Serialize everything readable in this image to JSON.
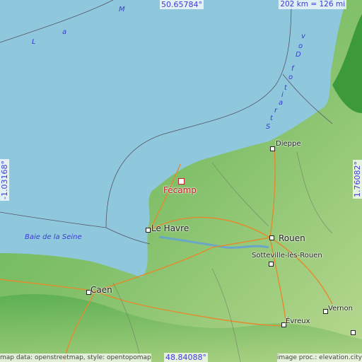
{
  "map": {
    "coordinates": {
      "north": "50.65784°",
      "south": "48.84088°",
      "west": "-1.03168°",
      "east": "1.76082°"
    },
    "scale_label": "202 km = 126 mi",
    "attribution_left": "map data: openstreetmap, style: opentopomap",
    "attribution_right": "image proc.: elevation.city",
    "highlighted_place": "Fécamp",
    "colors": {
      "sea": "#8fc8dc",
      "land_low": "#4fae4a",
      "land_high": "#d7e6a7",
      "highlight": "#c0202a",
      "roads": "#e58a2c"
    },
    "water_labels": {
      "la_manche": [
        "L",
        "a",
        "M"
      ],
      "strait": [
        "S",
        "t",
        "r",
        "a",
        "i",
        "t",
        "o",
        "f",
        "D",
        "o",
        "v"
      ],
      "baie": "Baie de la Seine"
    },
    "places": {
      "dieppe": "Dieppe",
      "le_havre": "Le Havre",
      "rouen": "Rouen",
      "sotteville": "Sotteville-lès-Rouen",
      "caen": "Caen",
      "evreux": "Évreux",
      "vernon": "Vernon"
    }
  }
}
